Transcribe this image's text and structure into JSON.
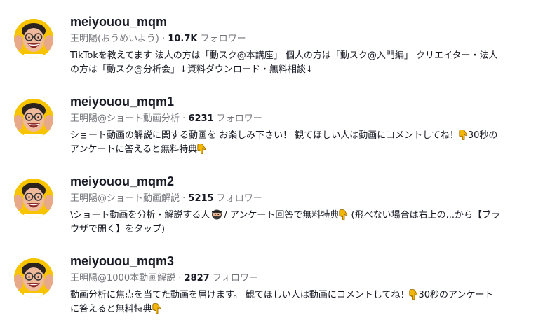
{
  "colors": {
    "avatar_bg": "#f8c400",
    "text_primary": "#161823",
    "text_secondary": "rgba(22,24,35,0.60)",
    "emoji_hand": "#f2b705"
  },
  "icons": {
    "avatar": "smiling-person-photo",
    "pointing_down": "backhand-index-pointing-down-emoji",
    "ninja": "ninja-emoji"
  },
  "results": [
    {
      "username": "meiyouou_mqm",
      "nickname": "王明陽(おうめいよう)",
      "separator": " · ",
      "followers_count": "10.7K",
      "followers_label": " フォロワー",
      "bio_line1": "TikTokを教えてます 法人の方は「動スク@本講座」 個人の方は「動スク@入門編」 クリエイター・法人",
      "bio_line2": "の方は「動スク@分析会」↓資料ダウンロード・無料相談↓"
    },
    {
      "username": "meiyouou_mqm1",
      "nickname": "王明陽@ショート動画分析",
      "separator": " · ",
      "followers_count": "6231",
      "followers_label": " フォロワー",
      "bio_line1_a": "ショート動画の解説に関する動画を お楽しみ下さい！ 観てほしい人は動画にコメントしてね！",
      "bio_line1_b": "30秒の",
      "bio_line2_a": "アンケートに答えると無料特典"
    },
    {
      "username": "meiyouou_mqm2",
      "nickname": "王明陽@ショート動画解説",
      "separator": " · ",
      "followers_count": "5215",
      "followers_label": " フォロワー",
      "bio_line1_a": "\\ショート動画を分析・解説する人",
      "bio_line1_b": "/ アンケート回答で無料特典",
      "bio_line1_c": " (飛べない場合は右上の...から【ブラ",
      "bio_line2_a": "ウザで開く】をタップ)"
    },
    {
      "username": "meiyouou_mqm3",
      "nickname": "王明陽@1000本動画解説",
      "separator": " · ",
      "followers_count": "2827",
      "followers_label": " フォロワー",
      "bio_line1_a": "動画分析に焦点を当てた動画を届けます。 観てほしい人は動画にコメントしてね！",
      "bio_line1_b": "30秒のアンケート",
      "bio_line2_a": "に答えると無料特典"
    }
  ]
}
